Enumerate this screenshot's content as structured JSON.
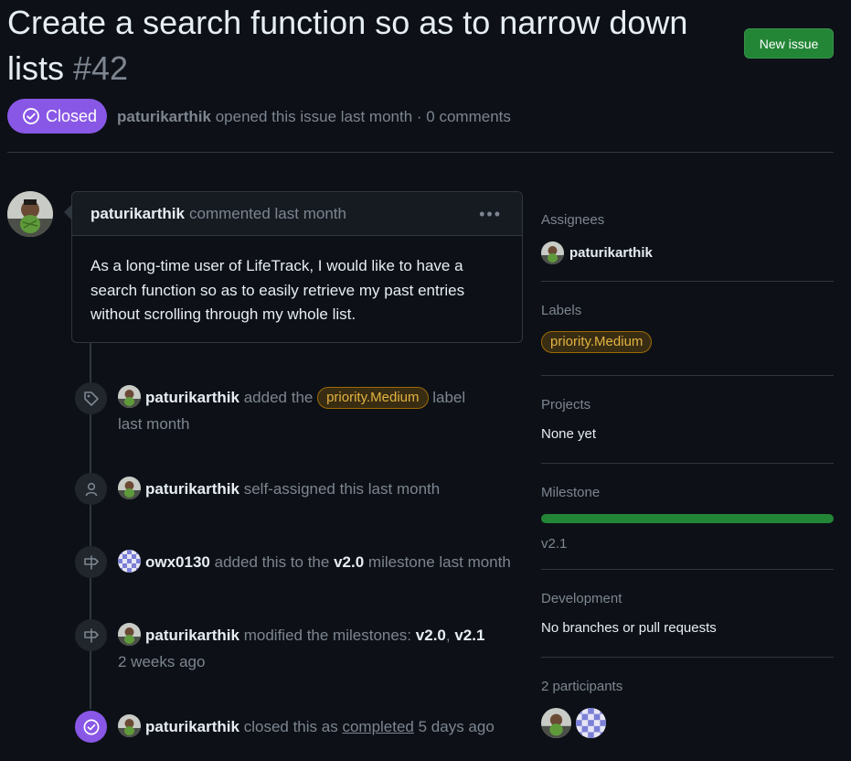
{
  "issue": {
    "title": "Create a search function so as to narrow down lists",
    "number": "#42",
    "state": "Closed",
    "author": "paturikarthik",
    "meta_rest": "opened this issue last month · 0 comments"
  },
  "header": {
    "new_issue_label": "New issue"
  },
  "comment": {
    "author": "paturikarthik",
    "meta": "commented last month",
    "more_icon": "kebab-horizontal-icon",
    "body": "As a long-time user of LifeTrack, I would like to have a search function so as to easily retrieve my past entries without scrolling through my whole list."
  },
  "timeline": [
    {
      "icon": "tag-icon",
      "actor": "paturikarthik",
      "pre": "added the",
      "label": "priority.Medium",
      "post": "label",
      "time": "last month"
    },
    {
      "icon": "person-icon",
      "actor": "paturikarthik",
      "text": "self-assigned this last month"
    },
    {
      "icon": "milestone-icon",
      "actor": "owx0130",
      "pre": "added this to the",
      "milestone": "v2.0",
      "post": "milestone last month"
    },
    {
      "icon": "milestone-icon",
      "actor": "paturikarthik",
      "pre": "modified the milestones:",
      "m1": "v2.0",
      "sep": ",",
      "m2": "v2.1",
      "time": "2 weeks ago"
    },
    {
      "icon": "check-circle-icon",
      "actor": "paturikarthik",
      "pre": "closed this as",
      "link": "completed",
      "post": "5 days ago"
    }
  ],
  "sidebar": {
    "assignees": {
      "heading": "Assignees",
      "user": "paturikarthik"
    },
    "labels": {
      "heading": "Labels",
      "label": "priority.Medium"
    },
    "projects": {
      "heading": "Projects",
      "value": "None yet"
    },
    "milestone": {
      "heading": "Milestone",
      "name": "v2.1",
      "progress": 1.0
    },
    "development": {
      "heading": "Development",
      "value": "No branches or pull requests"
    },
    "participants": {
      "heading": "2 participants"
    }
  },
  "colors": {
    "accent_done": "#8957e5",
    "primary_button": "#238636",
    "label_yellow": "#e3b341"
  }
}
